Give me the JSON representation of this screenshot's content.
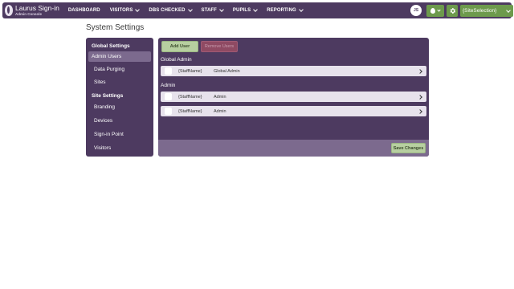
{
  "brand": {
    "title": "Laurus Sign-in",
    "subtitle": "Admin Console"
  },
  "nav": {
    "items": [
      {
        "label": "DASHBOARD",
        "has_dropdown": false
      },
      {
        "label": "VISITORS",
        "has_dropdown": true
      },
      {
        "label": "DBS CHECKED",
        "has_dropdown": true
      },
      {
        "label": "STAFF",
        "has_dropdown": true
      },
      {
        "label": "PUPILS",
        "has_dropdown": true
      },
      {
        "label": "REPORTING",
        "has_dropdown": true
      }
    ]
  },
  "header_right": {
    "avatar_initials": "JS",
    "fire_icon": "fire-icon",
    "settings_icon": "gear-icon",
    "site_select_value": "{SiteSelection}"
  },
  "page": {
    "title": "System Settings"
  },
  "sidebar": {
    "sections": [
      {
        "heading": "Global Settings",
        "items": [
          {
            "label": "Admin Users",
            "active": true
          },
          {
            "label": "Data Purging",
            "active": false
          },
          {
            "label": "Sites",
            "active": false
          }
        ]
      },
      {
        "heading": "Site Settings",
        "items": [
          {
            "label": "Branding",
            "active": false
          },
          {
            "label": "Devices",
            "active": false
          },
          {
            "label": "Sign-in Point",
            "active": false
          },
          {
            "label": "Visitors",
            "active": false
          }
        ]
      }
    ]
  },
  "main": {
    "add_user_label": "Add User",
    "remove_users_label": "Remove Users",
    "groups": [
      {
        "label": "Global Admin",
        "rows": [
          {
            "name": "{StaffName}",
            "role": "Global Admin"
          }
        ]
      },
      {
        "label": "Admin",
        "rows": [
          {
            "name": "{StaffName}",
            "role": "Admin"
          },
          {
            "name": "{StaffName}",
            "role": "Admin"
          }
        ]
      }
    ],
    "save_label": "Save Changes"
  },
  "colors": {
    "primary": "#4d3a60",
    "accent_green": "#6d9a4c",
    "button_green": "#b7cfa0",
    "remove_button": "#8f4a63",
    "row_background": "#e7e2ec",
    "footer": "#7c6a8e"
  }
}
